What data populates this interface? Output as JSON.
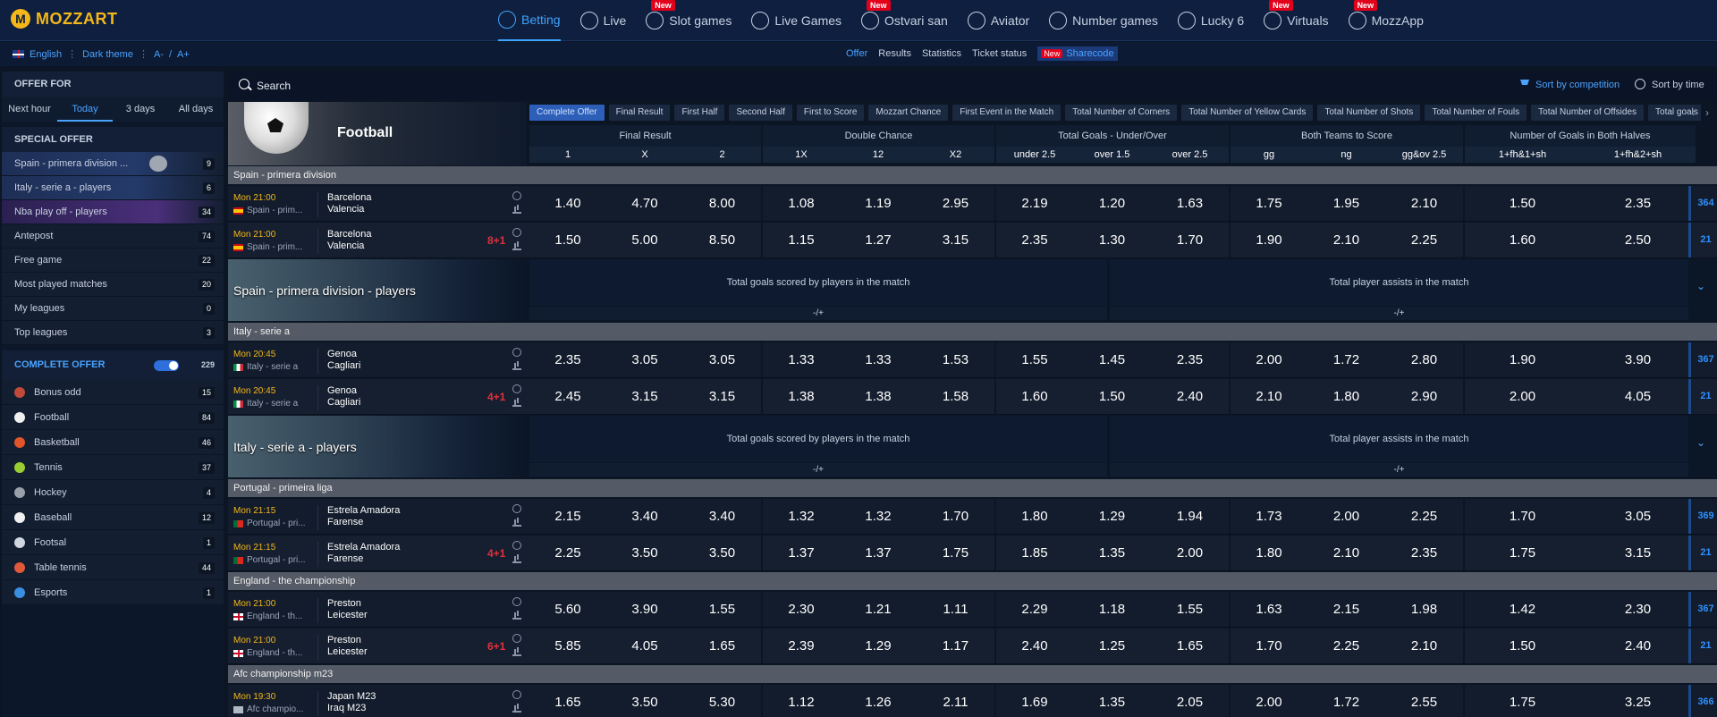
{
  "brand": {
    "logo_text": "MOZZART",
    "logo_letter": "M"
  },
  "nav": [
    {
      "label": "Betting",
      "icon": "football-icon",
      "active": true,
      "badge": ""
    },
    {
      "label": "Live",
      "icon": "live-icon",
      "badge": ""
    },
    {
      "label": "Slot games",
      "icon": "slot-icon",
      "badge": "New"
    },
    {
      "label": "Live Games",
      "icon": "live-games-icon",
      "badge": ""
    },
    {
      "label": "Ostvari san",
      "icon": "ostvari-icon",
      "badge": "New"
    },
    {
      "label": "Aviator",
      "icon": "plane-icon",
      "badge": ""
    },
    {
      "label": "Number games",
      "icon": "number-icon",
      "badge": ""
    },
    {
      "label": "Lucky 6",
      "icon": "lucky-icon",
      "badge": ""
    },
    {
      "label": "Virtuals",
      "icon": "virtuals-icon",
      "badge": "New"
    },
    {
      "label": "MozzApp",
      "icon": "app-icon",
      "badge": "New"
    }
  ],
  "prefs": {
    "language": "English",
    "theme": "Dark theme",
    "font_small": "A-",
    "font_sep": "/",
    "font_large": "A+"
  },
  "sublinks": {
    "offer": "Offer",
    "results": "Results",
    "statistics": "Statistics",
    "ticket_status": "Ticket status",
    "sharecode_badge": "New",
    "sharecode": "Sharecode"
  },
  "sidebar": {
    "offer_for": "OFFER FOR",
    "time_filters": [
      "Next hour",
      "Today",
      "3 days",
      "All days"
    ],
    "special_offer": "SPECIAL OFFER",
    "special_items": [
      {
        "label": "Spain - primera division ...",
        "count": "9"
      },
      {
        "label": "Italy - serie a - players",
        "count": "6"
      },
      {
        "label": "Nba play off - players",
        "count": "34"
      },
      {
        "label": "Antepost",
        "count": "74"
      },
      {
        "label": "Free game",
        "count": "22"
      },
      {
        "label": "Most played matches",
        "count": "20"
      },
      {
        "label": "My leagues",
        "count": "0"
      },
      {
        "label": "Top leagues",
        "count": "3"
      }
    ],
    "complete_offer": "COMPLETE OFFER",
    "complete_count": "229",
    "sports": [
      {
        "label": "Bonus odd",
        "count": "15",
        "color": "#c04a3a"
      },
      {
        "label": "Football",
        "count": "84",
        "color": "#f0f0f0"
      },
      {
        "label": "Basketball",
        "count": "46",
        "color": "#e0552a"
      },
      {
        "label": "Tennis",
        "count": "37",
        "color": "#9acd32"
      },
      {
        "label": "Hockey",
        "count": "4",
        "color": "#9aa0aa"
      },
      {
        "label": "Baseball",
        "count": "12",
        "color": "#f0f0f0"
      },
      {
        "label": "Footsal",
        "count": "1",
        "color": "#cfd6e0"
      },
      {
        "label": "Table tennis",
        "count": "44",
        "color": "#e05a3a"
      },
      {
        "label": "Esports",
        "count": "1",
        "color": "#3a8fe0"
      }
    ]
  },
  "search": {
    "label": "Search",
    "sort_competition": "Sort by competition",
    "sort_time": "Sort by time"
  },
  "sport_title": "Football",
  "market_tabs": [
    "Complete Offer",
    "Final Result",
    "First Half",
    "Second Half",
    "First to Score",
    "Mozzart Chance",
    "First Event in the Match",
    "Total Number of Corners",
    "Total Number of Yellow Cards",
    "Total Number of Shots",
    "Total Number of Fouls",
    "Total Number of Offsides",
    "Total goals"
  ],
  "groups": [
    "Final Result",
    "Double Chance",
    "Total Goals - Under/Over",
    "Both Teams to Score",
    "Number of Goals in Both Halves"
  ],
  "columns": [
    "1",
    "X",
    "2",
    "1X",
    "12",
    "X2",
    "under 2.5",
    "over 1.5",
    "over 2.5",
    "gg",
    "ng",
    "gg&ov 2.5",
    "1+fh&1+sh",
    "1+fh&2+sh"
  ],
  "sections": [
    {
      "type": "league",
      "name": "Spain - primera division"
    },
    {
      "type": "match",
      "time": "Mon 21:00",
      "league": "Spain - prim...",
      "home": "Barcelona",
      "away": "Valencia",
      "extra": "",
      "odds": [
        "1.40",
        "4.70",
        "8.00",
        "1.08",
        "1.19",
        "2.95",
        "2.19",
        "1.20",
        "1.63",
        "1.75",
        "1.95",
        "2.10",
        "1.50",
        "2.35"
      ],
      "more": "364",
      "flag": "es"
    },
    {
      "type": "match",
      "time": "Mon 21:00",
      "league": "Spain - prim...",
      "home": "Barcelona",
      "away": "Valencia",
      "extra": "8+1",
      "odds": [
        "1.50",
        "5.00",
        "8.50",
        "1.15",
        "1.27",
        "3.15",
        "2.35",
        "1.30",
        "1.70",
        "1.90",
        "2.10",
        "2.25",
        "1.60",
        "2.50"
      ],
      "more": "21",
      "flag": "es"
    },
    {
      "type": "players",
      "name": "Spain - primera division - players",
      "col1": "Total goals scored by players in the match",
      "col2": "Total player assists in the match",
      "sub1": "-/+",
      "sub2": "-/+"
    },
    {
      "type": "league",
      "name": "Italy - serie a"
    },
    {
      "type": "match",
      "time": "Mon 20:45",
      "league": "Italy - serie a",
      "home": "Genoa",
      "away": "Cagliari",
      "extra": "",
      "odds": [
        "2.35",
        "3.05",
        "3.05",
        "1.33",
        "1.33",
        "1.53",
        "1.55",
        "1.45",
        "2.35",
        "2.00",
        "1.72",
        "2.80",
        "1.90",
        "3.90"
      ],
      "more": "367",
      "flag": "it"
    },
    {
      "type": "match",
      "time": "Mon 20:45",
      "league": "Italy - serie a",
      "home": "Genoa",
      "away": "Cagliari",
      "extra": "4+1",
      "odds": [
        "2.45",
        "3.15",
        "3.15",
        "1.38",
        "1.38",
        "1.58",
        "1.60",
        "1.50",
        "2.40",
        "2.10",
        "1.80",
        "2.90",
        "2.00",
        "4.05"
      ],
      "more": "21",
      "flag": "it"
    },
    {
      "type": "players",
      "name": "Italy - serie a - players",
      "col1": "Total goals scored by players in the match",
      "col2": "Total player assists in the match",
      "sub1": "-/+",
      "sub2": "-/+"
    },
    {
      "type": "league",
      "name": "Portugal - primeira liga"
    },
    {
      "type": "match",
      "time": "Mon 21:15",
      "league": "Portugal - pri...",
      "home": "Estrela Amadora",
      "away": "Farense",
      "extra": "",
      "odds": [
        "2.15",
        "3.40",
        "3.40",
        "1.32",
        "1.32",
        "1.70",
        "1.80",
        "1.29",
        "1.94",
        "1.73",
        "2.00",
        "2.25",
        "1.70",
        "3.05"
      ],
      "more": "369",
      "flag": "pt"
    },
    {
      "type": "match",
      "time": "Mon 21:15",
      "league": "Portugal - pri...",
      "home": "Estrela Amadora",
      "away": "Farense",
      "extra": "4+1",
      "odds": [
        "2.25",
        "3.50",
        "3.50",
        "1.37",
        "1.37",
        "1.75",
        "1.85",
        "1.35",
        "2.00",
        "1.80",
        "2.10",
        "2.35",
        "1.75",
        "3.15"
      ],
      "more": "21",
      "flag": "pt"
    },
    {
      "type": "league",
      "name": "England - the championship"
    },
    {
      "type": "match",
      "time": "Mon 21:00",
      "league": "England - th...",
      "home": "Preston",
      "away": "Leicester",
      "extra": "",
      "odds": [
        "5.60",
        "3.90",
        "1.55",
        "2.30",
        "1.21",
        "1.11",
        "2.29",
        "1.18",
        "1.55",
        "1.63",
        "2.15",
        "1.98",
        "1.42",
        "2.30"
      ],
      "more": "367",
      "flag": "en"
    },
    {
      "type": "match",
      "time": "Mon 21:00",
      "league": "England - th...",
      "home": "Preston",
      "away": "Leicester",
      "extra": "6+1",
      "odds": [
        "5.85",
        "4.05",
        "1.65",
        "2.39",
        "1.29",
        "1.17",
        "2.40",
        "1.25",
        "1.65",
        "1.70",
        "2.25",
        "2.10",
        "1.50",
        "2.40"
      ],
      "more": "21",
      "flag": "en"
    },
    {
      "type": "league",
      "name": "Afc championship m23"
    },
    {
      "type": "match",
      "time": "Mon 19:30",
      "league": "Afc champio...",
      "home": "Japan M23",
      "away": "Iraq M23",
      "extra": "",
      "odds": [
        "1.65",
        "3.50",
        "5.30",
        "1.12",
        "1.26",
        "2.11",
        "1.69",
        "1.35",
        "2.05",
        "2.00",
        "1.72",
        "2.55",
        "1.75",
        "3.25"
      ],
      "more": "366",
      "flag": "asia"
    }
  ]
}
